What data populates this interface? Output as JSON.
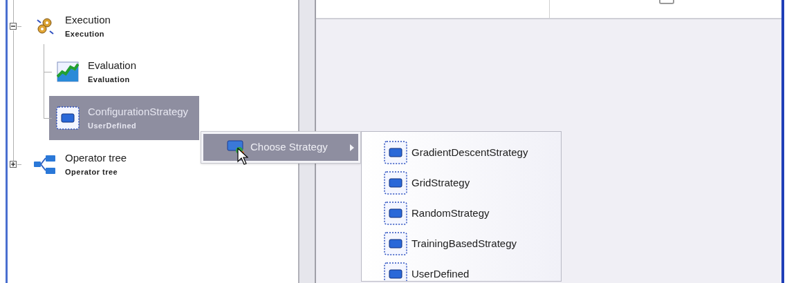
{
  "tree": [
    {
      "kind": "gears",
      "title": "Execution",
      "subtitle": "Execution",
      "expanded": true,
      "selected": false,
      "children": [
        {
          "kind": "chart",
          "title": "Evaluation",
          "subtitle": "Evaluation",
          "selected": false
        },
        {
          "kind": "strategy",
          "title": "ConfigurationStrategy",
          "subtitle": "UserDefined",
          "selected": true
        }
      ]
    },
    {
      "kind": "branches",
      "title": "Operator tree",
      "subtitle": "Operator tree",
      "expanded": false,
      "selected": false
    }
  ],
  "context_menu": {
    "items": [
      {
        "label": "Choose Strategy",
        "has_submenu": true,
        "selected": true
      }
    ]
  },
  "table_row": {
    "checked": false
  },
  "submenu": {
    "items": [
      {
        "label": "GradientDescentStrategy"
      },
      {
        "label": "GridStrategy"
      },
      {
        "label": "RandomStrategy"
      },
      {
        "label": "TrainingBasedStrategy"
      },
      {
        "label": "UserDefined"
      }
    ]
  }
}
